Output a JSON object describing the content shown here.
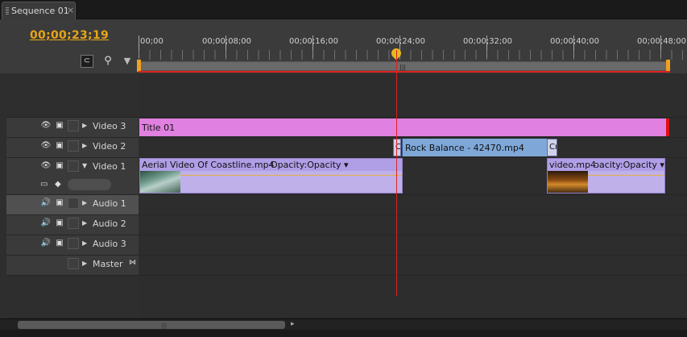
{
  "tab": {
    "title": "Sequence 01",
    "close": "×"
  },
  "timecode": "00;00;23;19",
  "toolbar": {
    "snap_icon": "snap-icon",
    "marker_icon": "set-marker-icon",
    "keyframe_icon": "keyframe-icon"
  },
  "ruler": {
    "labels": [
      "00;00",
      "00;00;08;00",
      "00;00;16;00",
      "00;00;24;00",
      "00;00;32;00",
      "00;00;40;00",
      "00;00;48;00"
    ]
  },
  "playhead_time": "00;00;23;19",
  "tracks": [
    {
      "name": "Video 3",
      "kind": "video"
    },
    {
      "name": "Video 2",
      "kind": "video"
    },
    {
      "name": "Video 1",
      "kind": "video",
      "expanded": true
    },
    {
      "name": "Audio 1",
      "kind": "audio",
      "selected": true
    },
    {
      "name": "Audio 2",
      "kind": "audio"
    },
    {
      "name": "Audio 3",
      "kind": "audio"
    },
    {
      "name": "Master",
      "kind": "master"
    }
  ],
  "clips": {
    "title01": {
      "label": "Title 01",
      "color": "#e080e0"
    },
    "transition_a": {
      "label": "C"
    },
    "rock": {
      "label": "Rock Balance - 42470.mp4",
      "color": "#7fa8d8"
    },
    "transition_b": {
      "label": "Cr"
    },
    "aerial": {
      "label": "Aerial Video Of Coastline.mp4",
      "effect": "Opacity:Opacity ▾"
    },
    "video": {
      "label": "video.mp4",
      "effect": "ɔacity:Opacity ▾"
    }
  },
  "colors": {
    "timecode": "#e8a516",
    "playhead": "#e02020",
    "work_area": "#f0a020"
  }
}
